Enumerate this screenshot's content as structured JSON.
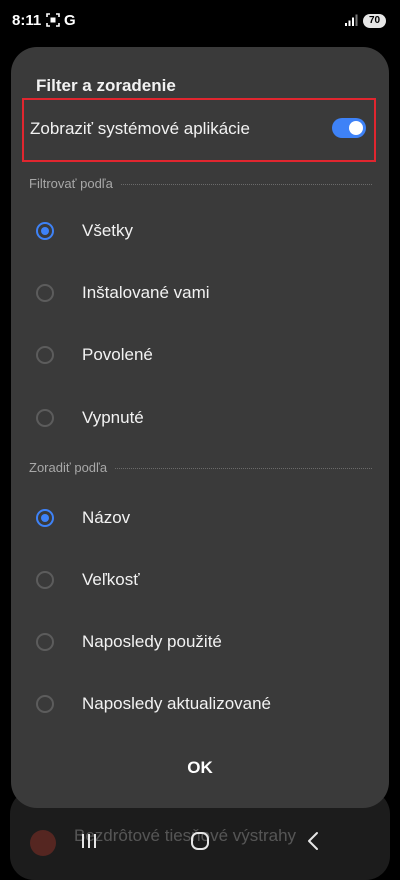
{
  "status_bar": {
    "time": "8:11",
    "g_label": "G",
    "battery": "70"
  },
  "background": {
    "item_label": "Bezdrôtové tiesňové výstrahy"
  },
  "dialog": {
    "title": "Filter a zoradenie",
    "toggle": {
      "label": "Zobraziť systémové aplikácie",
      "on": true
    },
    "filter_section": {
      "header": "Filtrovať podľa",
      "options": [
        {
          "label": "Všetky",
          "selected": true
        },
        {
          "label": "Inštalované vami",
          "selected": false
        },
        {
          "label": "Povolené",
          "selected": false
        },
        {
          "label": "Vypnuté",
          "selected": false
        }
      ]
    },
    "sort_section": {
      "header": "Zoradiť podľa",
      "options": [
        {
          "label": "Názov",
          "selected": true
        },
        {
          "label": "Veľkosť",
          "selected": false
        },
        {
          "label": "Naposledy použité",
          "selected": false
        },
        {
          "label": "Naposledy aktualizované",
          "selected": false
        }
      ]
    },
    "ok_label": "OK"
  },
  "colors": {
    "accent": "#3e82f7",
    "dialog_bg": "#3a3a3a",
    "highlight": "#e0262f"
  },
  "icons": {
    "screenshot": "screenshot-icon",
    "signal": "signal-icon",
    "recents": "recents-icon",
    "home": "home-icon",
    "back": "back-icon"
  }
}
